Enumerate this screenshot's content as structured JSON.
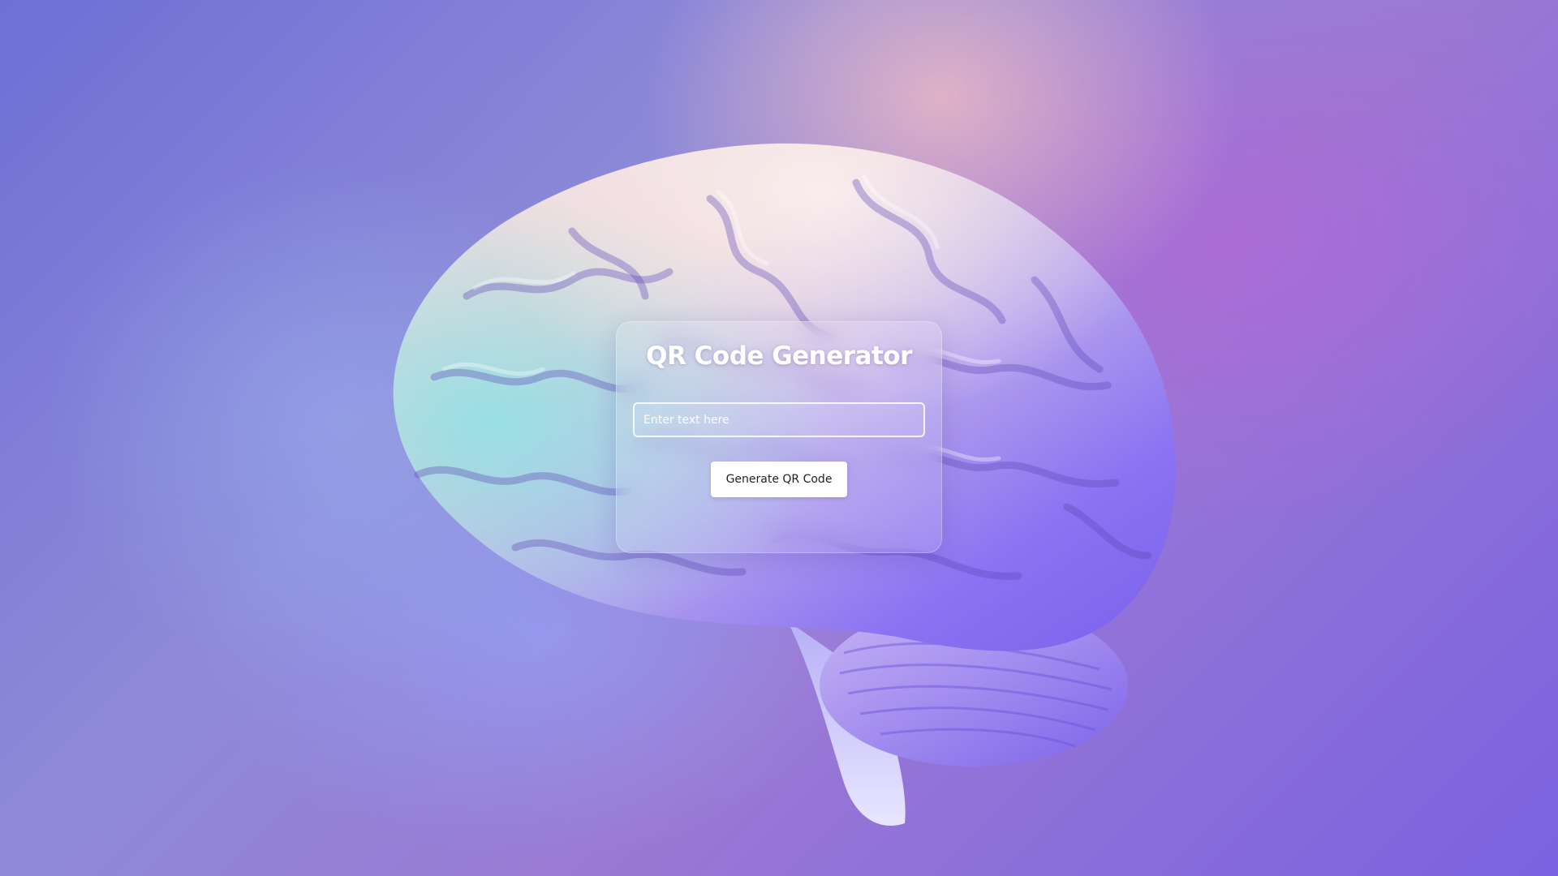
{
  "app": {
    "title": "QR Code Generator"
  },
  "form": {
    "input_placeholder": "Enter text here",
    "input_value": "",
    "button_label": "Generate QR Code"
  },
  "background": {
    "image_subject": "brain-illustration",
    "colors": {
      "base": "#7a6fd8",
      "pink_glow": "#ecbac4",
      "purple_glow": "#b068d6",
      "brain_light": "#f0dcdc",
      "brain_teal": "#7fd3e0",
      "brain_violet": "#8a70f0"
    }
  }
}
